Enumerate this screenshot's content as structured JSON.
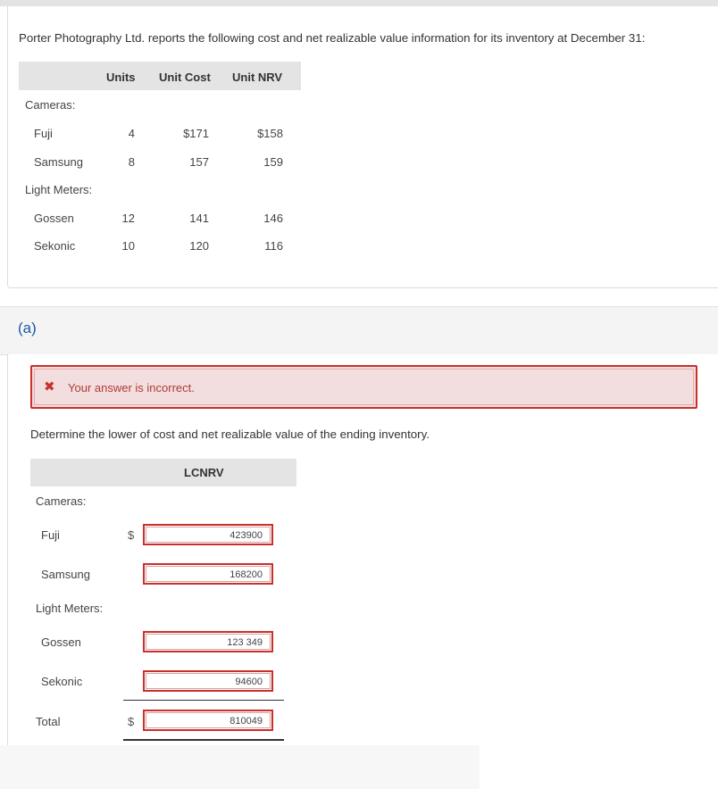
{
  "question": {
    "intro": "Porter Photography Ltd. reports the following cost and net realizable value information for its inventory at December 31:",
    "table": {
      "headers": {
        "units": "Units",
        "unit_cost": "Unit Cost",
        "unit_nrv": "Unit NRV"
      },
      "group_cameras": "Cameras:",
      "group_light_meters": "Light Meters:",
      "rows": [
        {
          "name": "Fuji",
          "units": "4",
          "unit_cost": "$171",
          "unit_nrv": "$158"
        },
        {
          "name": "Samsung",
          "units": "8",
          "unit_cost": "157",
          "unit_nrv": "159"
        },
        {
          "name": "Gossen",
          "units": "12",
          "unit_cost": "141",
          "unit_nrv": "146"
        },
        {
          "name": "Sekonic",
          "units": "10",
          "unit_cost": "120",
          "unit_nrv": "116"
        }
      ]
    }
  },
  "part": {
    "label": "(a)",
    "alert": {
      "icon": "x-mark-icon",
      "glyph": "✖",
      "text": "Your answer is incorrect."
    },
    "instruction": "Determine the lower of cost and net realizable value of the ending inventory.",
    "answer_table": {
      "header": "LCNRV",
      "group_cameras": "Cameras:",
      "group_light_meters": "Light Meters:",
      "currency": "$",
      "rows": [
        {
          "label": "Fuji",
          "value": "423900"
        },
        {
          "label": "Samsung",
          "value": "168200"
        },
        {
          "label": "Gossen",
          "value": "123 349"
        },
        {
          "label": "Sekonic",
          "value": "94600"
        }
      ],
      "total": {
        "label": "Total",
        "value": "810049"
      }
    }
  },
  "colors": {
    "error": "#c9302c",
    "alert_bg": "#f2dede",
    "header_bg": "#e4e4e4",
    "part_label": "#1c5aa8"
  }
}
